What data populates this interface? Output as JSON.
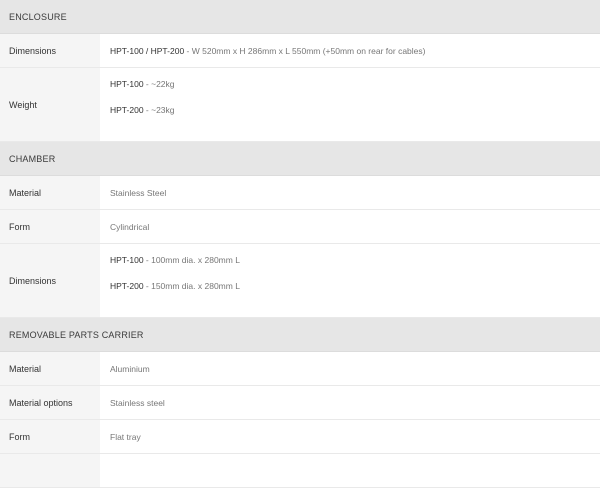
{
  "sections": [
    {
      "title": "ENCLOSURE",
      "rows": [
        {
          "label": "Dimensions",
          "lines": [
            {
              "model": "HPT-100 / HPT-200",
              "text": " - W 520mm x H 286mm x L 550mm (+50mm on rear for cables)"
            }
          ]
        },
        {
          "label": "Weight",
          "lines": [
            {
              "model": "HPT-100",
              "text": " - ~22kg"
            },
            {
              "model": "HPT-200",
              "text": " - ~23kg"
            }
          ]
        }
      ]
    },
    {
      "title": "CHAMBER",
      "rows": [
        {
          "label": "Material",
          "lines": [
            {
              "model": "",
              "text": "Stainless Steel"
            }
          ]
        },
        {
          "label": "Form",
          "lines": [
            {
              "model": "",
              "text": "Cylindrical"
            }
          ]
        },
        {
          "label": "Dimensions",
          "lines": [
            {
              "model": "HPT-100",
              "text": " - 100mm dia. x 280mm L"
            },
            {
              "model": "HPT-200",
              "text": " - 150mm dia. x 280mm L"
            }
          ]
        }
      ]
    },
    {
      "title": "REMOVABLE PARTS CARRIER",
      "rows": [
        {
          "label": "Material",
          "lines": [
            {
              "model": "",
              "text": "Aluminium"
            }
          ]
        },
        {
          "label": "Material options",
          "lines": [
            {
              "model": "",
              "text": "Stainless steel"
            }
          ]
        },
        {
          "label": "Form",
          "lines": [
            {
              "model": "",
              "text": "Flat tray"
            }
          ]
        }
      ]
    }
  ]
}
